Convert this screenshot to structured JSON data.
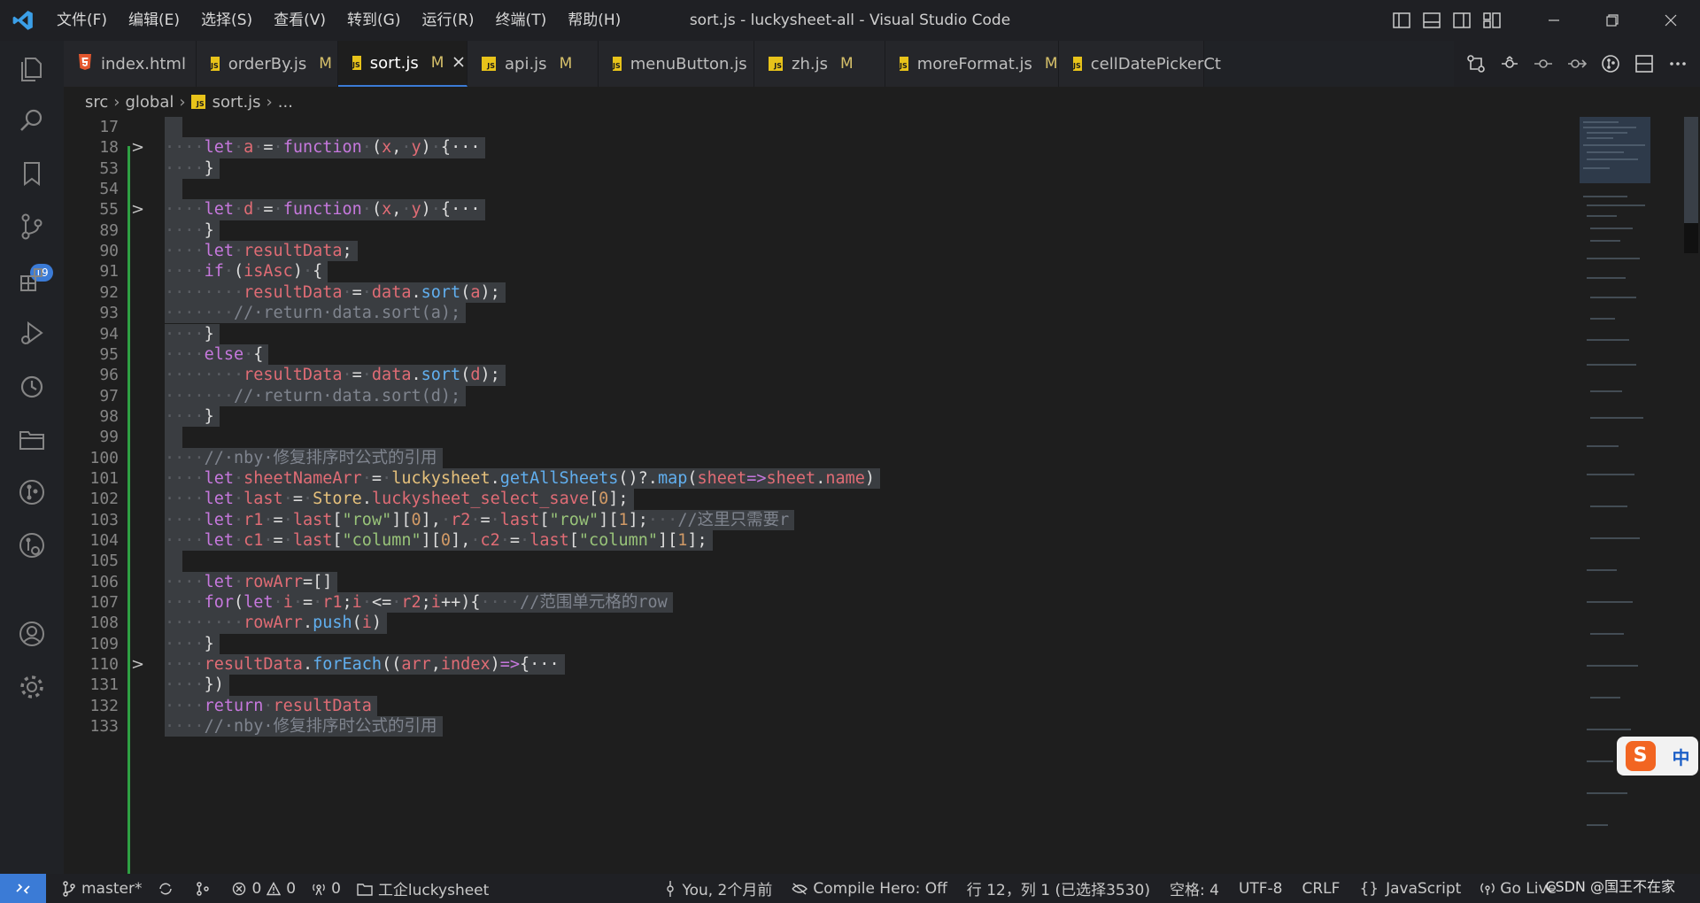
{
  "window": {
    "title": "sort.js - luckysheet-all - Visual Studio Code"
  },
  "menu": [
    "文件(F)",
    "编辑(E)",
    "选择(S)",
    "查看(V)",
    "转到(G)",
    "运行(R)",
    "终端(T)",
    "帮助(H)"
  ],
  "tabs": [
    {
      "label": "index.html",
      "icon": "html5-icon",
      "modified": "",
      "active": false
    },
    {
      "label": "orderBy.js",
      "icon": "js-file-icon",
      "modified": "M",
      "active": false
    },
    {
      "label": "sort.js",
      "icon": "js-file-icon",
      "modified": "M",
      "active": true
    },
    {
      "label": "api.js",
      "icon": "js-file-icon",
      "modified": "M",
      "active": false
    },
    {
      "label": "menuButton.js",
      "icon": "js-file-icon",
      "modified": "",
      "active": false
    },
    {
      "label": "zh.js",
      "icon": "js-file-icon",
      "modified": "M",
      "active": false
    },
    {
      "label": "moreFormat.js",
      "icon": "js-file-icon",
      "modified": "M",
      "active": false
    },
    {
      "label": "cellDatePickerCt",
      "icon": "js-file-icon",
      "modified": "",
      "active": false
    }
  ],
  "breadcrumb": {
    "segments": [
      "src",
      "global",
      "sort.js",
      "..."
    ]
  },
  "activity": {
    "source_control_badge": "19"
  },
  "editor": {
    "lines": [
      {
        "n": "17",
        "fold": "",
        "tokens": []
      },
      {
        "n": "18",
        "fold": ">",
        "tokens": [
          [
            "ws",
            "····"
          ],
          [
            "kw",
            "let"
          ],
          [
            "ws",
            "·"
          ],
          [
            "var",
            "a"
          ],
          [
            "ws",
            "·"
          ],
          [
            "pl",
            "="
          ],
          [
            "ws",
            "·"
          ],
          [
            "kw",
            "function"
          ],
          [
            "ws",
            "·"
          ],
          [
            "pl",
            "("
          ],
          [
            "var",
            "x"
          ],
          [
            "pl",
            ","
          ],
          [
            "ws",
            "·"
          ],
          [
            "var",
            "y"
          ],
          [
            "pl",
            ")"
          ],
          [
            "ws",
            "·"
          ],
          [
            "pl",
            "{"
          ],
          [
            "pl",
            "···"
          ]
        ]
      },
      {
        "n": "53",
        "fold": "",
        "tokens": [
          [
            "ws",
            "····"
          ],
          [
            "pl",
            "}"
          ]
        ]
      },
      {
        "n": "54",
        "fold": "",
        "tokens": []
      },
      {
        "n": "55",
        "fold": ">",
        "tokens": [
          [
            "ws",
            "····"
          ],
          [
            "kw",
            "let"
          ],
          [
            "ws",
            "·"
          ],
          [
            "var",
            "d"
          ],
          [
            "ws",
            "·"
          ],
          [
            "pl",
            "="
          ],
          [
            "ws",
            "·"
          ],
          [
            "kw",
            "function"
          ],
          [
            "ws",
            "·"
          ],
          [
            "pl",
            "("
          ],
          [
            "var",
            "x"
          ],
          [
            "pl",
            ","
          ],
          [
            "ws",
            "·"
          ],
          [
            "var",
            "y"
          ],
          [
            "pl",
            ")"
          ],
          [
            "ws",
            "·"
          ],
          [
            "pl",
            "{"
          ],
          [
            "pl",
            "···"
          ]
        ]
      },
      {
        "n": "89",
        "fold": "",
        "tokens": [
          [
            "ws",
            "····"
          ],
          [
            "pl",
            "}"
          ]
        ]
      },
      {
        "n": "90",
        "fold": "",
        "tokens": [
          [
            "ws",
            "····"
          ],
          [
            "kw",
            "let"
          ],
          [
            "ws",
            "·"
          ],
          [
            "var",
            "resultData"
          ],
          [
            "pl",
            ";"
          ]
        ]
      },
      {
        "n": "91",
        "fold": "",
        "tokens": [
          [
            "ws",
            "····"
          ],
          [
            "kw",
            "if"
          ],
          [
            "ws",
            "·"
          ],
          [
            "pl",
            "("
          ],
          [
            "var",
            "isAsc"
          ],
          [
            "pl",
            ")"
          ],
          [
            "ws",
            "·"
          ],
          [
            "pl",
            "{"
          ]
        ]
      },
      {
        "n": "92",
        "fold": "",
        "tokens": [
          [
            "ws",
            "········"
          ],
          [
            "var",
            "resultData"
          ],
          [
            "ws",
            "·"
          ],
          [
            "pl",
            "="
          ],
          [
            "ws",
            "·"
          ],
          [
            "var",
            "data"
          ],
          [
            "pl",
            "."
          ],
          [
            "fn",
            "sort"
          ],
          [
            "pl",
            "("
          ],
          [
            "var",
            "a"
          ],
          [
            "pl",
            ");"
          ]
        ]
      },
      {
        "n": "93",
        "fold": "",
        "tokens": [
          [
            "ws",
            "·······"
          ],
          [
            "cm",
            "//·return·data.sort(a);"
          ]
        ]
      },
      {
        "n": "94",
        "fold": "",
        "tokens": [
          [
            "ws",
            "····"
          ],
          [
            "pl",
            "}"
          ]
        ]
      },
      {
        "n": "95",
        "fold": "",
        "tokens": [
          [
            "ws",
            "····"
          ],
          [
            "kw",
            "else"
          ],
          [
            "ws",
            "·"
          ],
          [
            "pl",
            "{"
          ]
        ]
      },
      {
        "n": "96",
        "fold": "",
        "tokens": [
          [
            "ws",
            "········"
          ],
          [
            "var",
            "resultData"
          ],
          [
            "ws",
            "·"
          ],
          [
            "pl",
            "="
          ],
          [
            "ws",
            "·"
          ],
          [
            "var",
            "data"
          ],
          [
            "pl",
            "."
          ],
          [
            "fn",
            "sort"
          ],
          [
            "pl",
            "("
          ],
          [
            "var",
            "d"
          ],
          [
            "pl",
            ");"
          ]
        ]
      },
      {
        "n": "97",
        "fold": "",
        "tokens": [
          [
            "ws",
            "·······"
          ],
          [
            "cm",
            "//·return·data.sort(d);"
          ]
        ]
      },
      {
        "n": "98",
        "fold": "",
        "tokens": [
          [
            "ws",
            "····"
          ],
          [
            "pl",
            "}"
          ]
        ]
      },
      {
        "n": "99",
        "fold": "",
        "tokens": []
      },
      {
        "n": "100",
        "fold": "",
        "tokens": [
          [
            "ws",
            "····"
          ],
          [
            "cm",
            "//·nby·修复排序时公式的引用"
          ]
        ]
      },
      {
        "n": "101",
        "fold": "",
        "tokens": [
          [
            "ws",
            "····"
          ],
          [
            "kw",
            "let"
          ],
          [
            "ws",
            "·"
          ],
          [
            "var",
            "sheetNameArr"
          ],
          [
            "ws",
            "·"
          ],
          [
            "pl",
            "="
          ],
          [
            "ws",
            "·"
          ],
          [
            "cls",
            "luckysheet"
          ],
          [
            "pl",
            "."
          ],
          [
            "fn",
            "getAllSheets"
          ],
          [
            "pl",
            "()?."
          ],
          [
            "fn",
            "map"
          ],
          [
            "pl",
            "("
          ],
          [
            "var",
            "sheet"
          ],
          [
            "kw",
            "=>"
          ],
          [
            "var",
            "sheet"
          ],
          [
            "pl",
            "."
          ],
          [
            "var",
            "name"
          ],
          [
            "pl",
            ")"
          ]
        ]
      },
      {
        "n": "102",
        "fold": "",
        "tokens": [
          [
            "ws",
            "····"
          ],
          [
            "kw",
            "let"
          ],
          [
            "ws",
            "·"
          ],
          [
            "var",
            "last"
          ],
          [
            "ws",
            "·"
          ],
          [
            "pl",
            "="
          ],
          [
            "ws",
            "·"
          ],
          [
            "cls",
            "Store"
          ],
          [
            "pl",
            "."
          ],
          [
            "var",
            "luckysheet_select_save"
          ],
          [
            "pl",
            "["
          ],
          [
            "num",
            "0"
          ],
          [
            "pl",
            "];"
          ]
        ]
      },
      {
        "n": "103",
        "fold": "",
        "tokens": [
          [
            "ws",
            "····"
          ],
          [
            "kw",
            "let"
          ],
          [
            "ws",
            "·"
          ],
          [
            "var",
            "r1"
          ],
          [
            "ws",
            "·"
          ],
          [
            "pl",
            "="
          ],
          [
            "ws",
            "·"
          ],
          [
            "var",
            "last"
          ],
          [
            "pl",
            "["
          ],
          [
            "str",
            "\"row\""
          ],
          [
            "pl",
            "]["
          ],
          [
            "num",
            "0"
          ],
          [
            "pl",
            "],"
          ],
          [
            "ws",
            "·"
          ],
          [
            "var",
            "r2"
          ],
          [
            "ws",
            "·"
          ],
          [
            "pl",
            "="
          ],
          [
            "ws",
            "·"
          ],
          [
            "var",
            "last"
          ],
          [
            "pl",
            "["
          ],
          [
            "str",
            "\"row\""
          ],
          [
            "pl",
            "]["
          ],
          [
            "num",
            "1"
          ],
          [
            "pl",
            "];"
          ],
          [
            "ws",
            "···"
          ],
          [
            "cm",
            "//这里只需要r"
          ]
        ]
      },
      {
        "n": "104",
        "fold": "",
        "tokens": [
          [
            "ws",
            "····"
          ],
          [
            "kw",
            "let"
          ],
          [
            "ws",
            "·"
          ],
          [
            "var",
            "c1"
          ],
          [
            "ws",
            "·"
          ],
          [
            "pl",
            "="
          ],
          [
            "ws",
            "·"
          ],
          [
            "var",
            "last"
          ],
          [
            "pl",
            "["
          ],
          [
            "str",
            "\"column\""
          ],
          [
            "pl",
            "]["
          ],
          [
            "num",
            "0"
          ],
          [
            "pl",
            "],"
          ],
          [
            "ws",
            "·"
          ],
          [
            "var",
            "c2"
          ],
          [
            "ws",
            "·"
          ],
          [
            "pl",
            "="
          ],
          [
            "ws",
            "·"
          ],
          [
            "var",
            "last"
          ],
          [
            "pl",
            "["
          ],
          [
            "str",
            "\"column\""
          ],
          [
            "pl",
            "]["
          ],
          [
            "num",
            "1"
          ],
          [
            "pl",
            "];"
          ]
        ]
      },
      {
        "n": "105",
        "fold": "",
        "tokens": []
      },
      {
        "n": "106",
        "fold": "",
        "tokens": [
          [
            "ws",
            "····"
          ],
          [
            "kw",
            "let"
          ],
          [
            "ws",
            "·"
          ],
          [
            "var",
            "rowArr"
          ],
          [
            "pl",
            "=[]"
          ]
        ]
      },
      {
        "n": "107",
        "fold": "",
        "tokens": [
          [
            "ws",
            "····"
          ],
          [
            "kw",
            "for"
          ],
          [
            "pl",
            "("
          ],
          [
            "kw",
            "let"
          ],
          [
            "ws",
            "·"
          ],
          [
            "var",
            "i"
          ],
          [
            "ws",
            "·"
          ],
          [
            "pl",
            "="
          ],
          [
            "ws",
            "·"
          ],
          [
            "var",
            "r1"
          ],
          [
            "pl",
            ";"
          ],
          [
            "var",
            "i"
          ],
          [
            "ws",
            "·"
          ],
          [
            "pl",
            "<="
          ],
          [
            "ws",
            "·"
          ],
          [
            "var",
            "r2"
          ],
          [
            "pl",
            ";"
          ],
          [
            "var",
            "i"
          ],
          [
            "pl",
            "++){"
          ],
          [
            "ws",
            "····"
          ],
          [
            "cm",
            "//范围单元格的row"
          ]
        ]
      },
      {
        "n": "108",
        "fold": "",
        "tokens": [
          [
            "ws",
            "········"
          ],
          [
            "var",
            "rowArr"
          ],
          [
            "pl",
            "."
          ],
          [
            "fn",
            "push"
          ],
          [
            "pl",
            "("
          ],
          [
            "var",
            "i"
          ],
          [
            "pl",
            ")"
          ]
        ]
      },
      {
        "n": "109",
        "fold": "",
        "tokens": [
          [
            "ws",
            "····"
          ],
          [
            "pl",
            "}"
          ]
        ]
      },
      {
        "n": "110",
        "fold": ">",
        "tokens": [
          [
            "ws",
            "····"
          ],
          [
            "var",
            "resultData"
          ],
          [
            "pl",
            "."
          ],
          [
            "fn",
            "forEach"
          ],
          [
            "pl",
            "(("
          ],
          [
            "var",
            "arr"
          ],
          [
            "pl",
            ","
          ],
          [
            "var",
            "index"
          ],
          [
            "pl",
            ")"
          ],
          [
            "kw",
            "=>"
          ],
          [
            "pl",
            "{"
          ],
          [
            "pl",
            "···"
          ]
        ]
      },
      {
        "n": "131",
        "fold": "",
        "tokens": [
          [
            "ws",
            "····"
          ],
          [
            "pl",
            "})"
          ]
        ]
      },
      {
        "n": "132",
        "fold": "",
        "tokens": [
          [
            "ws",
            "····"
          ],
          [
            "kw",
            "return"
          ],
          [
            "ws",
            "·"
          ],
          [
            "var",
            "resultData"
          ]
        ]
      },
      {
        "n": "133",
        "fold": "",
        "tokens": [
          [
            "ws",
            "····"
          ],
          [
            "cm",
            "//·nby·修复排序时公式的引用"
          ]
        ]
      }
    ]
  },
  "ime": {
    "label": "中"
  },
  "status": {
    "branch": "master*",
    "errors": "0",
    "warnings": "0",
    "ports": "0",
    "folder": "工企luckysheet",
    "blame": "You, 2个月前",
    "compile_hero": "Compile Hero: Off",
    "position": "行 12，列 1 (已选择3530)",
    "indent": "空格: 4",
    "encoding": "UTF-8",
    "eol": "CRLF",
    "language": "JavaScript",
    "go_live": "Go Live",
    "watermark": "CSDN @国王不在家"
  },
  "colors": {
    "accent": "#3b7bd6",
    "git_added": "#2ea043",
    "selection": "#3a3d41"
  }
}
